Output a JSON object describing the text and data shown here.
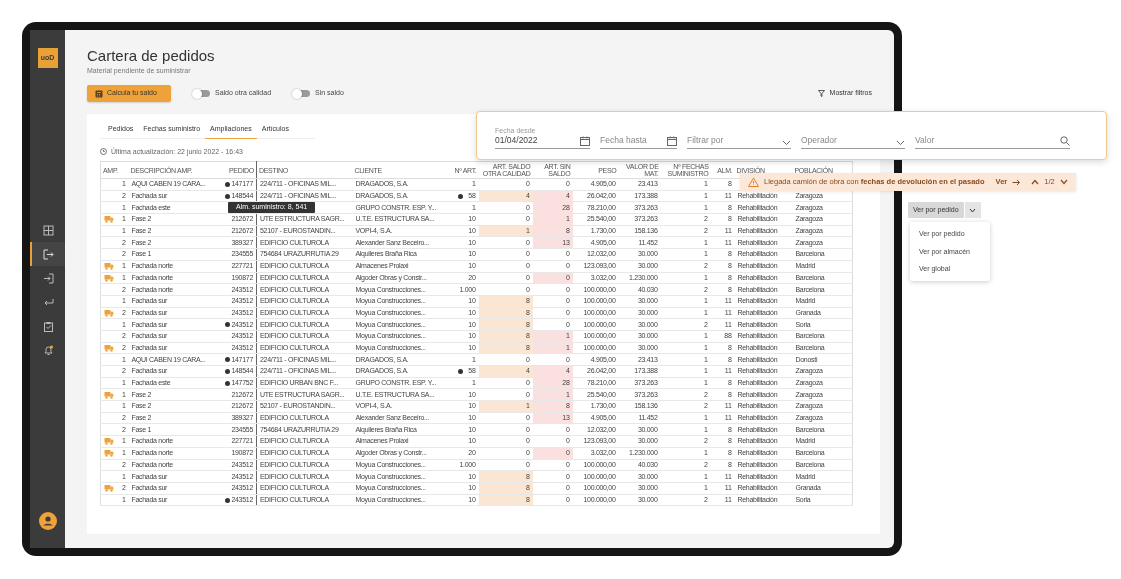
{
  "sidebar": {
    "logo": "uoD",
    "items": [
      {
        "kind": "grid",
        "selected": false
      },
      {
        "kind": "logout",
        "selected": true
      },
      {
        "kind": "login",
        "selected": false
      },
      {
        "kind": "return",
        "selected": false
      },
      {
        "kind": "clipboard",
        "selected": false
      },
      {
        "kind": "bell",
        "selected": false
      }
    ]
  },
  "header": {
    "title": "Cartera de pedidos",
    "subtitle": "Material pendiente de suministrar",
    "action_button": "Calcula tu saldo",
    "toggles": [
      {
        "label": "Saldo otra calidad",
        "on": false
      },
      {
        "label": "Sin saldo",
        "on": false
      }
    ],
    "filters_button": "Mostrar filtros"
  },
  "tabs": [
    {
      "label": "Pedidos",
      "selected": false
    },
    {
      "label": "Fechas suministro",
      "selected": false
    },
    {
      "label": "Ampliaciones",
      "selected": true
    },
    {
      "label": "Artículos",
      "selected": false
    }
  ],
  "last_update": "Última actualización: 22 junio 2022 - 16:43",
  "table": {
    "columns": [
      "AMP.",
      "DESCRIPCIÓN AMP.",
      "PEDIDO",
      "DESTINO",
      "CLIENTE",
      "Nº ART.",
      "ART. SALDO OTRA CALIDAD",
      "ART. SIN SALDO",
      "PESO",
      "VALOR DE MAT.",
      "Nº FECHAS SUMINISTRO",
      "ALM.",
      "DIVISIÓN",
      "POBLACIÓN"
    ],
    "rows": [
      {
        "icon": false,
        "amp": "1",
        "description": "AQUI CABEN 19 CARA...",
        "pedido_flag": true,
        "pedido": "147177",
        "destino": "224/711 - OFICINAS MIL...",
        "cliente": "DRAGADOS, S.A.",
        "art_flag": false,
        "n_art": "1",
        "saldo_otra": "0",
        "saldo_otra_alert": false,
        "sin_saldo": "0",
        "sin_saldo_alert": false,
        "peso": "4.905,00",
        "valor": "23.413",
        "fechas": "1",
        "alm": "8"
      },
      {
        "icon": false,
        "amp": "2",
        "description": "Fachada sur",
        "pedido_flag": true,
        "pedido": "148544",
        "destino": "224/711 - OFICINAS MIL...",
        "cliente": "DRAGADOS, S.A.",
        "art_flag": true,
        "n_art": "58",
        "saldo_otra": "4",
        "saldo_otra_alert": true,
        "sin_saldo": "4",
        "sin_saldo_alert": true,
        "peso": "26.042,00",
        "valor": "173.388",
        "fechas": "1",
        "alm": "11",
        "division": "Rehabilitación",
        "poblacion": "Zaragoza"
      },
      {
        "icon": false,
        "amp": "1",
        "description": "Fachada este",
        "pedido_flag": true,
        "cliente": "GRUPO CONSTR. ESP. Y...",
        "art_flag": false,
        "n_art": "1",
        "saldo_otra": "0",
        "saldo_otra_alert": false,
        "sin_saldo": "28",
        "sin_saldo_alert": true,
        "peso": "78.210,00",
        "valor": "373.263",
        "fechas": "1",
        "alm": "8",
        "division": "Rehabilitación",
        "poblacion": "Zaragoza"
      },
      {
        "icon": true,
        "amp": "1",
        "description": "Fase 2",
        "pedido_flag": false,
        "pedido": "212672",
        "destino": "UTE ESTRUCTURA SAGR...",
        "cliente": "U.T.E. ESTRUCTURA SA...",
        "art_flag": false,
        "n_art": "10",
        "saldo_otra": "0",
        "saldo_otra_alert": false,
        "sin_saldo": "1",
        "sin_saldo_alert": true,
        "peso": "25.540,00",
        "valor": "373.263",
        "fechas": "2",
        "alm": "8",
        "division": "Rehabilitación",
        "poblacion": "Zaragoza"
      },
      {
        "icon": false,
        "amp": "1",
        "description": "Fase 2",
        "pedido_flag": false,
        "pedido": "212672",
        "destino": "52107 - EUROSTANDIN...",
        "cliente": "VOPI-4, S.A.",
        "art_flag": false,
        "n_art": "10",
        "saldo_otra": "1",
        "saldo_otra_alert": true,
        "sin_saldo": "8",
        "sin_saldo_alert": true,
        "peso": "1.730,00",
        "valor": "158.136",
        "fechas": "2",
        "alm": "11",
        "division": "Rehabilitación",
        "poblacion": "Zaragoza"
      },
      {
        "icon": false,
        "amp": "2",
        "description": "Fase 2",
        "pedido_flag": false,
        "pedido": "389327",
        "destino": "EDIFICIO CULTUROLA",
        "cliente": "Alexander Sanz Beceiro...",
        "art_flag": false,
        "n_art": "10",
        "saldo_otra": "0",
        "saldo_otra_alert": false,
        "sin_saldo": "13",
        "sin_saldo_alert": true,
        "peso": "4.905,00",
        "valor": "11.452",
        "fechas": "1",
        "alm": "11",
        "division": "Rehabilitación",
        "poblacion": "Zaragoza"
      },
      {
        "icon": false,
        "amp": "2",
        "description": "Fase 1",
        "pedido_flag": false,
        "pedido": "234555",
        "destino": "754684 URAZURRUTIA 29",
        "cliente": "Alquileres Braña Rica",
        "art_flag": false,
        "n_art": "10",
        "saldo_otra": "0",
        "saldo_otra_alert": false,
        "sin_saldo": "0",
        "sin_saldo_alert": false,
        "peso": "12.032,00",
        "valor": "30.000",
        "fechas": "1",
        "alm": "8",
        "division": "Rehabilitación",
        "poblacion": "Barcelona"
      },
      {
        "icon": true,
        "amp": "1",
        "description": "Fachada norte",
        "pedido_flag": false,
        "pedido": "227721",
        "destino": "EDIFICIO CULTUROLA",
        "cliente": "Almacenes Prolaxi",
        "art_flag": false,
        "n_art": "10",
        "saldo_otra": "0",
        "saldo_otra_alert": false,
        "sin_saldo": "0",
        "sin_saldo_alert": false,
        "peso": "123.093,00",
        "valor": "30.000",
        "fechas": "2",
        "alm": "8",
        "division": "Rehabilitación",
        "poblacion": "Madrid"
      },
      {
        "icon": true,
        "amp": "1",
        "description": "Fachada norte",
        "pedido_flag": false,
        "pedido": "190872",
        "destino": "EDIFICIO CULTUROLA",
        "cliente": "Algoder Obras y Constr...",
        "art_flag": false,
        "n_art": "20",
        "saldo_otra": "0",
        "saldo_otra_alert": false,
        "sin_saldo": "0",
        "sin_saldo_alert": true,
        "peso": "3.032,00",
        "valor": "1.230.000",
        "fechas": "1",
        "alm": "8",
        "division": "Rehabilitación",
        "poblacion": "Barcelona"
      },
      {
        "icon": false,
        "amp": "2",
        "description": "Fachada norte",
        "pedido_flag": false,
        "pedido": "243512",
        "destino": "EDIFICIO CULTUROLA",
        "cliente": "Moyua Construcciones...",
        "art_flag": false,
        "n_art": "1.000",
        "saldo_otra": "0",
        "saldo_otra_alert": false,
        "sin_saldo": "0",
        "sin_saldo_alert": false,
        "peso": "100.000,00",
        "valor": "40.030",
        "fechas": "2",
        "alm": "8",
        "division": "Rehabilitación",
        "poblacion": "Barcelona"
      },
      {
        "icon": false,
        "amp": "1",
        "description": "Fachada sur",
        "pedido_flag": false,
        "pedido": "243512",
        "destino": "EDIFICIO CULTUROLA",
        "cliente": "Moyua Construcciones...",
        "art_flag": false,
        "n_art": "10",
        "saldo_otra": "8",
        "saldo_otra_alert": true,
        "sin_saldo": "0",
        "sin_saldo_alert": false,
        "peso": "100.000,00",
        "valor": "30.000",
        "fechas": "1",
        "alm": "11",
        "division": "Rehabilitación",
        "poblacion": "Madrid"
      },
      {
        "icon": true,
        "amp": "2",
        "description": "Fachada sur",
        "pedido_flag": false,
        "pedido": "243512",
        "destino": "EDIFICIO CULTUROLA",
        "cliente": "Moyua Construcciones...",
        "art_flag": false,
        "n_art": "10",
        "saldo_otra": "8",
        "saldo_otra_alert": true,
        "sin_saldo": "0",
        "sin_saldo_alert": false,
        "peso": "100.000,00",
        "valor": "30.000",
        "fechas": "1",
        "alm": "11",
        "division": "Rehabilitación",
        "poblacion": "Granada"
      },
      {
        "icon": false,
        "amp": "1",
        "description": "Fachada sur",
        "pedido_flag": true,
        "pedido": "243512",
        "destino": "EDIFICIO CULTUROLA",
        "cliente": "Moyua Construcciones...",
        "art_flag": false,
        "n_art": "10",
        "saldo_otra": "8",
        "saldo_otra_alert": true,
        "sin_saldo": "0",
        "sin_saldo_alert": false,
        "peso": "100.000,00",
        "valor": "30.000",
        "fechas": "2",
        "alm": "11",
        "division": "Rehabilitación",
        "poblacion": "Soria"
      },
      {
        "icon": false,
        "amp": "2",
        "description": "Fachada sur",
        "pedido_flag": false,
        "pedido": "243512",
        "destino": "EDIFICIO CULTUROLA",
        "cliente": "Moyua Construcciones...",
        "art_flag": false,
        "n_art": "10",
        "saldo_otra": "8",
        "saldo_otra_alert": true,
        "sin_saldo": "1",
        "sin_saldo_alert": true,
        "peso": "100.000,00",
        "valor": "30.000",
        "fechas": "1",
        "alm": "88",
        "division": "Rehabilitación",
        "poblacion": "Barcelona"
      },
      {
        "icon": true,
        "amp": "2",
        "description": "Fachada sur",
        "pedido_flag": false,
        "pedido": "243512",
        "destino": "EDIFICIO CULTUROLA",
        "cliente": "Moyua Construcciones...",
        "art_flag": false,
        "n_art": "10",
        "saldo_otra": "8",
        "saldo_otra_alert": true,
        "sin_saldo": "1",
        "sin_saldo_alert": true,
        "peso": "100.000,00",
        "valor": "30.000",
        "fechas": "1",
        "alm": "8",
        "division": "Rehabilitación",
        "poblacion": "Barcelona"
      },
      {
        "icon": false,
        "amp": "1",
        "description": "AQUI CABEN 19 CARA...",
        "pedido_flag": true,
        "pedido": "147177",
        "destino": "224/711 - OFICINAS MIL...",
        "cliente": "DRAGADOS, S.A.",
        "art_flag": false,
        "n_art": "1",
        "saldo_otra": "0",
        "saldo_otra_alert": false,
        "sin_saldo": "0",
        "sin_saldo_alert": false,
        "peso": "4.905,00",
        "valor": "23.413",
        "fechas": "1",
        "alm": "8",
        "division": "Rehabilitación",
        "poblacion": "Donosti"
      },
      {
        "icon": false,
        "amp": "2",
        "description": "Fachada sur",
        "pedido_flag": true,
        "pedido": "148544",
        "destino": "224/711 - OFICINAS MIL...",
        "cliente": "DRAGADOS, S.A.",
        "art_flag": true,
        "n_art": "58",
        "saldo_otra": "4",
        "saldo_otra_alert": true,
        "sin_saldo": "4",
        "sin_saldo_alert": true,
        "peso": "26.042,00",
        "valor": "173.388",
        "fechas": "1",
        "alm": "11",
        "division": "Rehabilitación",
        "poblacion": "Zaragoza"
      },
      {
        "icon": false,
        "amp": "1",
        "description": "Fachada este",
        "pedido_flag": true,
        "pedido": "147752",
        "destino": "EDIFICIO URBAN BNC F...",
        "cliente": "GRUPO CONSTR. ESP. Y...",
        "art_flag": false,
        "n_art": "1",
        "saldo_otra": "0",
        "saldo_otra_alert": false,
        "sin_saldo": "28",
        "sin_saldo_alert": true,
        "peso": "78.210,00",
        "valor": "373.263",
        "fechas": "1",
        "alm": "8",
        "division": "Rehabilitación",
        "poblacion": "Zaragoza"
      },
      {
        "icon": true,
        "amp": "1",
        "description": "Fase 2",
        "pedido_flag": false,
        "pedido": "212672",
        "destino": "UTE ESTRUCTURA SAGR...",
        "cliente": "U.T.E. ESTRUCTURA SA...",
        "art_flag": false,
        "n_art": "10",
        "saldo_otra": "0",
        "saldo_otra_alert": false,
        "sin_saldo": "1",
        "sin_saldo_alert": true,
        "peso": "25.540,00",
        "valor": "373.263",
        "fechas": "2",
        "alm": "8",
        "division": "Rehabilitación",
        "poblacion": "Zaragoza"
      },
      {
        "icon": false,
        "amp": "1",
        "description": "Fase 2",
        "pedido_flag": false,
        "pedido": "212672",
        "destino": "52107 - EUROSTANDIN...",
        "cliente": "VOPI-4, S.A.",
        "art_flag": false,
        "n_art": "10",
        "saldo_otra": "1",
        "saldo_otra_alert": true,
        "sin_saldo": "8",
        "sin_saldo_alert": true,
        "peso": "1.730,00",
        "valor": "158.136",
        "fechas": "2",
        "alm": "11",
        "division": "Rehabilitación",
        "poblacion": "Zaragoza"
      },
      {
        "icon": false,
        "amp": "2",
        "description": "Fase 2",
        "pedido_flag": false,
        "pedido": "389327",
        "destino": "EDIFICIO CULTUROLA",
        "cliente": "Alexander Sanz Beceiro...",
        "art_flag": false,
        "n_art": "10",
        "saldo_otra": "0",
        "saldo_otra_alert": false,
        "sin_saldo": "13",
        "sin_saldo_alert": true,
        "peso": "4.905,00",
        "valor": "11.452",
        "fechas": "1",
        "alm": "11",
        "division": "Rehabilitación",
        "poblacion": "Zaragoza"
      },
      {
        "icon": false,
        "amp": "2",
        "description": "Fase 1",
        "pedido_flag": false,
        "pedido": "234555",
        "destino": "754684 URAZURRUTIA 29",
        "cliente": "Alquileres Braña Rica",
        "art_flag": false,
        "n_art": "10",
        "saldo_otra": "0",
        "saldo_otra_alert": false,
        "sin_saldo": "0",
        "sin_saldo_alert": false,
        "peso": "12.032,00",
        "valor": "30.000",
        "fechas": "1",
        "alm": "8",
        "division": "Rehabilitación",
        "poblacion": "Barcelona"
      },
      {
        "icon": true,
        "amp": "1",
        "description": "Fachada norte",
        "pedido_flag": false,
        "pedido": "227721",
        "destino": "EDIFICIO CULTUROLA",
        "cliente": "Almacenes Prolaxi",
        "art_flag": false,
        "n_art": "10",
        "saldo_otra": "0",
        "saldo_otra_alert": false,
        "sin_saldo": "0",
        "sin_saldo_alert": false,
        "peso": "123.093,00",
        "valor": "30.000",
        "fechas": "2",
        "alm": "8",
        "division": "Rehabilitación",
        "poblacion": "Madrid"
      },
      {
        "icon": true,
        "amp": "1",
        "description": "Fachada norte",
        "pedido_flag": false,
        "pedido": "190872",
        "destino": "EDIFICIO CULTUROLA",
        "cliente": "Algoder Obras y Constr...",
        "art_flag": false,
        "n_art": "20",
        "saldo_otra": "0",
        "saldo_otra_alert": false,
        "sin_saldo": "0",
        "sin_saldo_alert": true,
        "peso": "3.032,00",
        "valor": "1.230.000",
        "fechas": "1",
        "alm": "8",
        "division": "Rehabilitación",
        "poblacion": "Barcelona"
      },
      {
        "icon": false,
        "amp": "2",
        "description": "Fachada norte",
        "pedido_flag": false,
        "pedido": "243512",
        "destino": "EDIFICIO CULTUROLA",
        "cliente": "Moyua Construcciones...",
        "art_flag": false,
        "n_art": "1.000",
        "saldo_otra": "0",
        "saldo_otra_alert": false,
        "sin_saldo": "0",
        "sin_saldo_alert": false,
        "peso": "100.000,00",
        "valor": "40.030",
        "fechas": "2",
        "alm": "8",
        "division": "Rehabilitación",
        "poblacion": "Barcelona"
      },
      {
        "icon": false,
        "amp": "1",
        "description": "Fachada sur",
        "pedido_flag": false,
        "pedido": "243512",
        "destino": "EDIFICIO CULTUROLA",
        "cliente": "Moyua Construcciones...",
        "art_flag": false,
        "n_art": "10",
        "saldo_otra": "8",
        "saldo_otra_alert": true,
        "sin_saldo": "0",
        "sin_saldo_alert": false,
        "peso": "100.000,00",
        "valor": "30.000",
        "fechas": "1",
        "alm": "11",
        "division": "Rehabilitación",
        "poblacion": "Madrid"
      },
      {
        "icon": true,
        "amp": "2",
        "description": "Fachada sur",
        "pedido_flag": false,
        "pedido": "243512",
        "destino": "EDIFICIO CULTUROLA",
        "cliente": "Moyua Construcciones...",
        "art_flag": false,
        "n_art": "10",
        "saldo_otra": "8",
        "saldo_otra_alert": true,
        "sin_saldo": "0",
        "sin_saldo_alert": false,
        "peso": "100.000,00",
        "valor": "30.000",
        "fechas": "1",
        "alm": "11",
        "division": "Rehabilitación",
        "poblacion": "Granada"
      },
      {
        "icon": false,
        "amp": "1",
        "description": "Fachada sur",
        "pedido_flag": true,
        "pedido": "243512",
        "destino": "EDIFICIO CULTUROLA",
        "cliente": "Moyua Construcciones...",
        "art_flag": false,
        "n_art": "10",
        "saldo_otra": "8",
        "saldo_otra_alert": true,
        "sin_saldo": "0",
        "sin_saldo_alert": false,
        "peso": "100.000,00",
        "valor": "30.000",
        "fechas": "2",
        "alm": "11",
        "division": "Rehabilitación",
        "poblacion": "Soria"
      }
    ]
  },
  "tooltip": "Alm. suministro: 8, 541",
  "filter_panel": {
    "fields": [
      {
        "kind": "date",
        "label": "Fecha desde",
        "value": "01/04/2022"
      },
      {
        "kind": "date",
        "placeholder": "Fecha hasta"
      },
      {
        "kind": "select",
        "placeholder": "Filtrar por"
      },
      {
        "kind": "select",
        "placeholder": "Operador"
      },
      {
        "kind": "search",
        "placeholder": "Valor"
      }
    ]
  },
  "alert": {
    "message": "Llegada camión de obra con **fechas de devolución en el pasado**",
    "link": "Ver",
    "counter": "1/2"
  },
  "view_selector": {
    "label": "Ver por pedido",
    "options": [
      "Ver por pedido",
      "Ver por almacén",
      "Ver global"
    ]
  }
}
